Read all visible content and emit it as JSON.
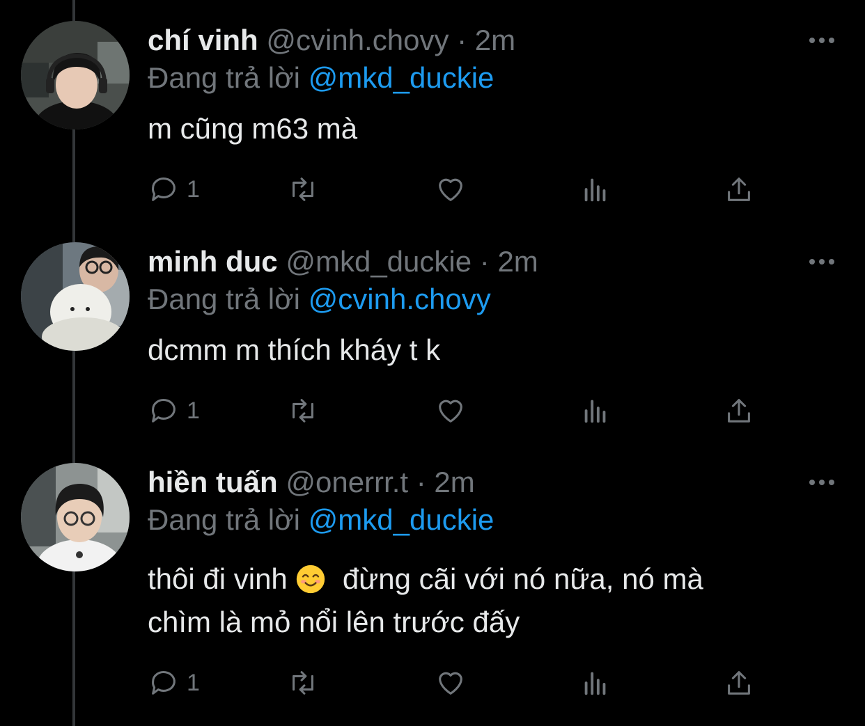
{
  "icons": {
    "reply": "reply-icon",
    "retweet": "retweet-icon",
    "like": "heart-icon",
    "views": "views-icon",
    "share": "share-icon",
    "more": "more-icon"
  },
  "colors": {
    "background": "#000000",
    "text": "#e7e9ea",
    "muted": "#71767b",
    "link": "#1d9bf0",
    "line": "#333639"
  },
  "tweets": [
    {
      "name": "chí vinh",
      "handle": "@cvinh.chovy",
      "separator": "·",
      "time": "2m",
      "replying_label": "Đang trả lời",
      "replying_to": "@mkd_duckie",
      "text_lines": [
        "m cũng m63 mà"
      ],
      "reply_count": "1"
    },
    {
      "name": "minh duc",
      "handle": "@mkd_duckie",
      "separator": "·",
      "time": "2m",
      "replying_label": "Đang trả lời",
      "replying_to": "@cvinh.chovy",
      "text_lines": [
        "dcmm m thích kháy t k"
      ],
      "reply_count": "1"
    },
    {
      "name": "hiền tuấn",
      "handle": "@onerrr.t",
      "separator": "·",
      "time": "2m",
      "replying_label": "Đang trả lời",
      "replying_to": "@mkd_duckie",
      "text_line1_before": "thôi đi vinh",
      "text_line1_after": "đừng cãi với nó nữa, nó mà",
      "text_line2": "chìm là mỏ nổi lên trước đấy",
      "emoji": "smiling-face-emoji",
      "reply_count": "1"
    }
  ]
}
